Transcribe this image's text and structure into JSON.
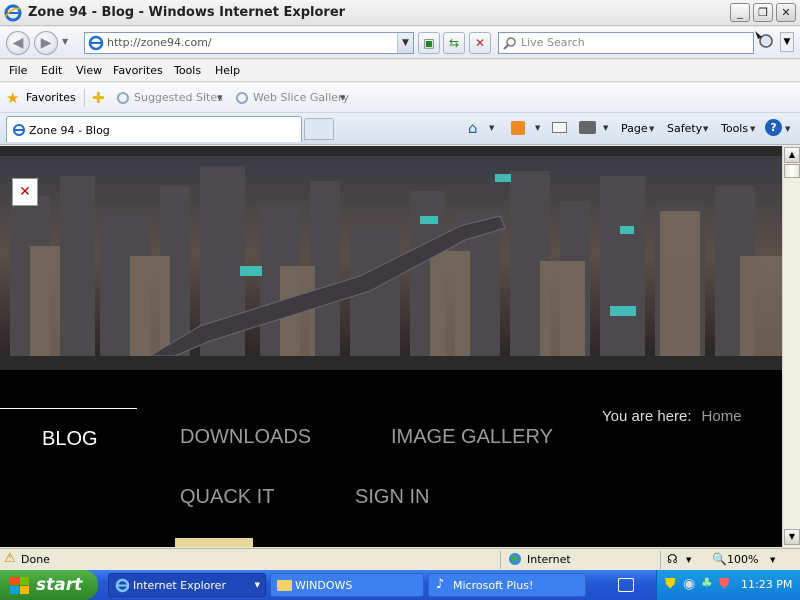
{
  "window": {
    "title": "Zone 94 - Blog - Windows Internet Explorer",
    "minimize": "_",
    "restore": "❐",
    "close": "✕"
  },
  "address_bar": {
    "url": "http://zone94.com/",
    "search_placeholder": "Live Search"
  },
  "menu": {
    "file": "File",
    "edit": "Edit",
    "view": "View",
    "favorites": "Favorites",
    "tools": "Tools",
    "help": "Help"
  },
  "favorites_bar": {
    "favorites": "Favorites",
    "suggested_sites": "Suggested Sites",
    "web_slice_gallery": "Web Slice Gallery"
  },
  "tab": {
    "label": "Zone 94 - Blog"
  },
  "command_bar": {
    "page": "Page",
    "safety": "Safety",
    "tools": "Tools"
  },
  "site_nav": {
    "blog": "BLOG",
    "downloads": "DOWNLOADS",
    "image_gallery": "IMAGE GALLERY",
    "quack_it": "QUACK IT",
    "sign_in": "SIGN IN",
    "you_are_here": "You are here:",
    "home": "Home"
  },
  "status_bar": {
    "status": "Done",
    "zone": "Internet",
    "zoom": "100%"
  },
  "taskbar": {
    "start": "start",
    "items": [
      {
        "label": "Internet Explorer"
      },
      {
        "label": "WINDOWS"
      },
      {
        "label": "Microsoft Plus!"
      }
    ],
    "clock": "11:23 PM"
  },
  "colors": {
    "nav_active_text": "#ffffff",
    "nav_text": "#9a9a9a",
    "page_bg": "#000000",
    "xp_blue": "#2559d6",
    "xp_green": "#3b9a33"
  }
}
